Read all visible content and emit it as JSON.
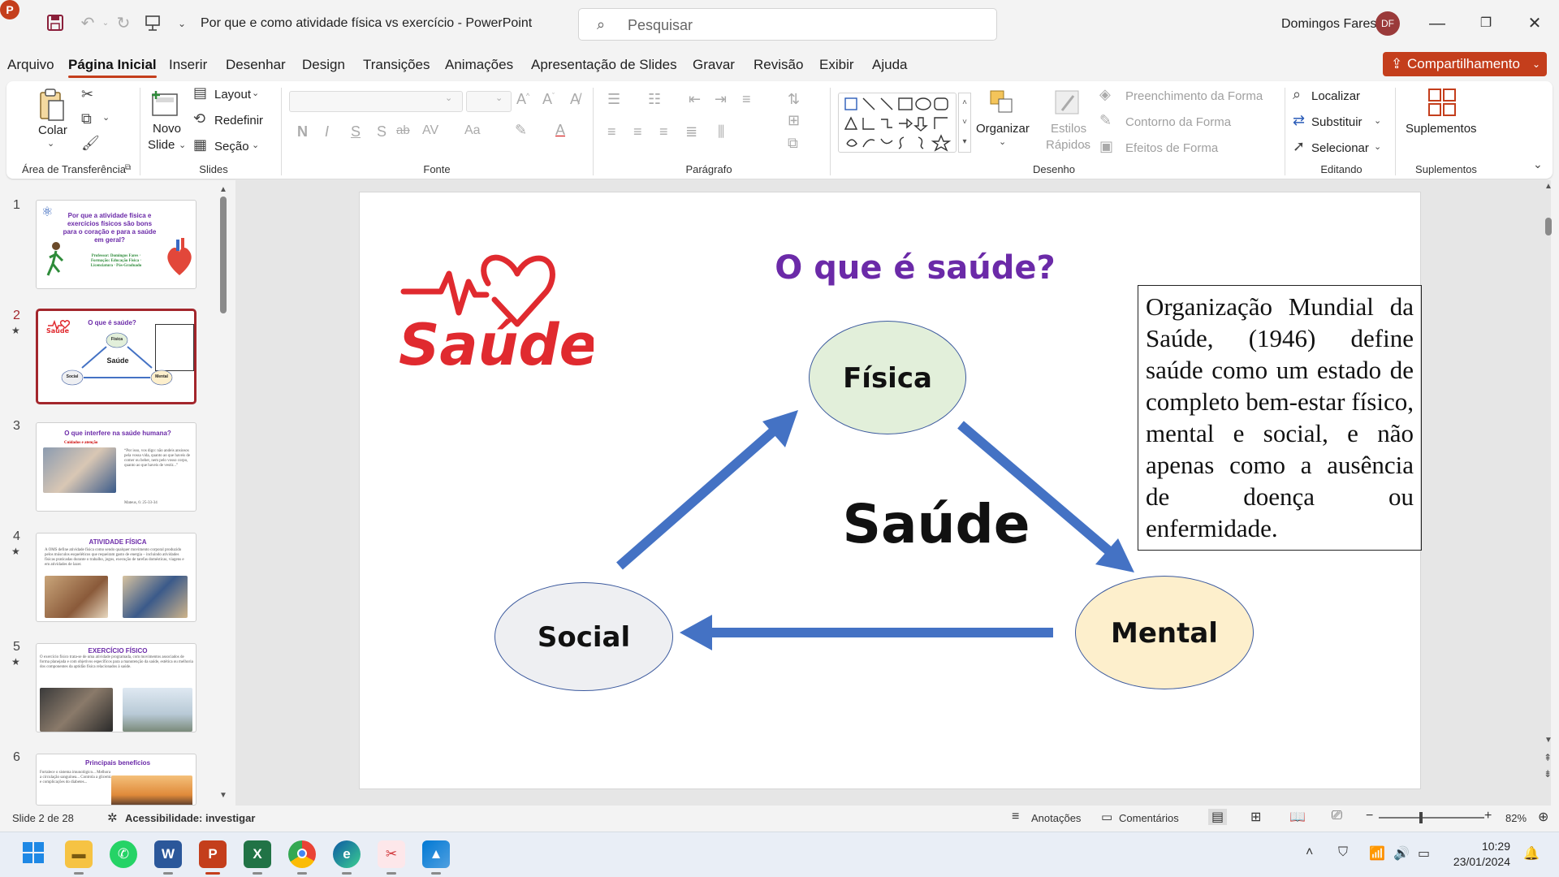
{
  "titlebar": {
    "app_icon_letter": "P",
    "document_title": "Por que e como atividade física vs exercício  -  PowerPoint",
    "search_placeholder": "Pesquisar",
    "user_name": "Domingos Fares",
    "user_initials": "DF"
  },
  "menu": {
    "tabs": [
      "Arquivo",
      "Página Inicial",
      "Inserir",
      "Desenhar",
      "Design",
      "Transições",
      "Animações",
      "Apresentação de Slides",
      "Gravar",
      "Revisão",
      "Exibir",
      "Ajuda"
    ],
    "active_tab": "Página Inicial",
    "share_label": "Compartilhamento"
  },
  "ribbon": {
    "clipboard": {
      "paste_label": "Colar",
      "group_label": "Área de Transferência"
    },
    "slides": {
      "new_slide_label_1": "Novo",
      "new_slide_label_2": "Slide",
      "layout_label": "Layout",
      "reset_label": "Redefinir",
      "section_label": "Seção",
      "group_label": "Slides"
    },
    "font": {
      "bold": "N",
      "italic": "I",
      "underline": "S",
      "shadow": "S",
      "strike": "ab",
      "spacing": "AV",
      "case": "Aa",
      "group_label": "Fonte"
    },
    "paragraph": {
      "group_label": "Parágrafo"
    },
    "drawing": {
      "arrange_label": "Organizar",
      "quick_styles_label_1": "Estilos",
      "quick_styles_label_2": "Rápidos",
      "fill_label": "Preenchimento da Forma",
      "outline_label": "Contorno da Forma",
      "effects_label": "Efeitos de Forma",
      "group_label": "Desenho"
    },
    "editing": {
      "find_label": "Localizar",
      "replace_label": "Substituir",
      "select_label": "Selecionar",
      "group_label": "Editando"
    },
    "addins": {
      "label": "Suplementos",
      "group_label": "Suplementos"
    }
  },
  "thumbnails": [
    {
      "number": "1",
      "star": false,
      "title": "Por que a atividade física e exercícios físicos são bons para o coração e para a saúde em geral?",
      "subtitle": "Professor: Domingos Fares · Formação: Educação Física · Licenciatura · Pós-Graduado"
    },
    {
      "number": "2",
      "star": true,
      "selected": true,
      "title": "O que é saúde?",
      "center": "Saúde",
      "nodes": [
        "Física",
        "Social",
        "Mental"
      ]
    },
    {
      "number": "3",
      "star": false,
      "title": "O que interfere na saúde humana?",
      "subtitle": "Cuidados e atenção",
      "text": "“Por isso, vos digo: não andeis ansiosos pela vossa vida, quanto ao que haveis de comer ou beber, nem pelo vosso corpo, quanto ao que haveis de vestir...”",
      "ref": "Mateus, 6: 25-33-34"
    },
    {
      "number": "4",
      "star": true,
      "title": "ATIVIDADE FÍSICA",
      "text": "A OMS define atividade física como sendo qualquer movimento corporal produzido pelos músculos esqueléticos que requeiram gasto de energia – incluindo atividades físicas praticadas durante o trabalho, jogos, execução de tarefas domésticas, viagens e em atividades de lazer."
    },
    {
      "number": "5",
      "star": true,
      "title": "EXERCÍCIO FÍSICO",
      "text": "O exercício físico trata-se de uma atividade programada, com movimentos associados de forma planejada e com objetivos específicos para a manutenção da saúde, estética ou melhoria dos componentes da aptidão física relacionados à saúde."
    },
    {
      "number": "6",
      "star": false,
      "title": "Principais benefícios",
      "text": "Fortalece o sistema imunológico... Melhora a circulação sanguínea... Controla a glicemia e complicações do diabetes..."
    }
  ],
  "slide": {
    "title": "O que é saúde?",
    "logo_word": "Saúde",
    "center_word": "Saúde",
    "nodes": {
      "top": {
        "label": "Física",
        "fill": "#e2efda"
      },
      "left": {
        "label": "Social",
        "fill": "#eeeff2"
      },
      "right": {
        "label": "Mental",
        "fill": "#fdefcc"
      }
    },
    "quote": "Organização Mundial da Saúde, (1946) define saúde como um estado de completo bem-estar físico, mental e social, e não apenas como a ausência de doença ou enfermidade.",
    "arrow_color": "#4472c4",
    "title_color": "#6b2aa8",
    "logo_color": "#e02a2f"
  },
  "statusbar": {
    "slide_position": "Slide 2 de 28",
    "accessibility": "Acessibilidade: investigar",
    "notes_label": "Anotações",
    "comments_label": "Comentários",
    "zoom_level": "82%",
    "zoom_minus": "−",
    "zoom_plus": "+"
  },
  "taskbar": {
    "apps": [
      "start",
      "file-explorer",
      "whatsapp",
      "word",
      "powerpoint",
      "excel",
      "chrome",
      "edge",
      "snipping-tool",
      "photos"
    ],
    "time": "10:29",
    "date": "23/01/2024"
  },
  "colors": {
    "accent": "#c43e1c",
    "selected_thumb_border": "#a3262c"
  }
}
